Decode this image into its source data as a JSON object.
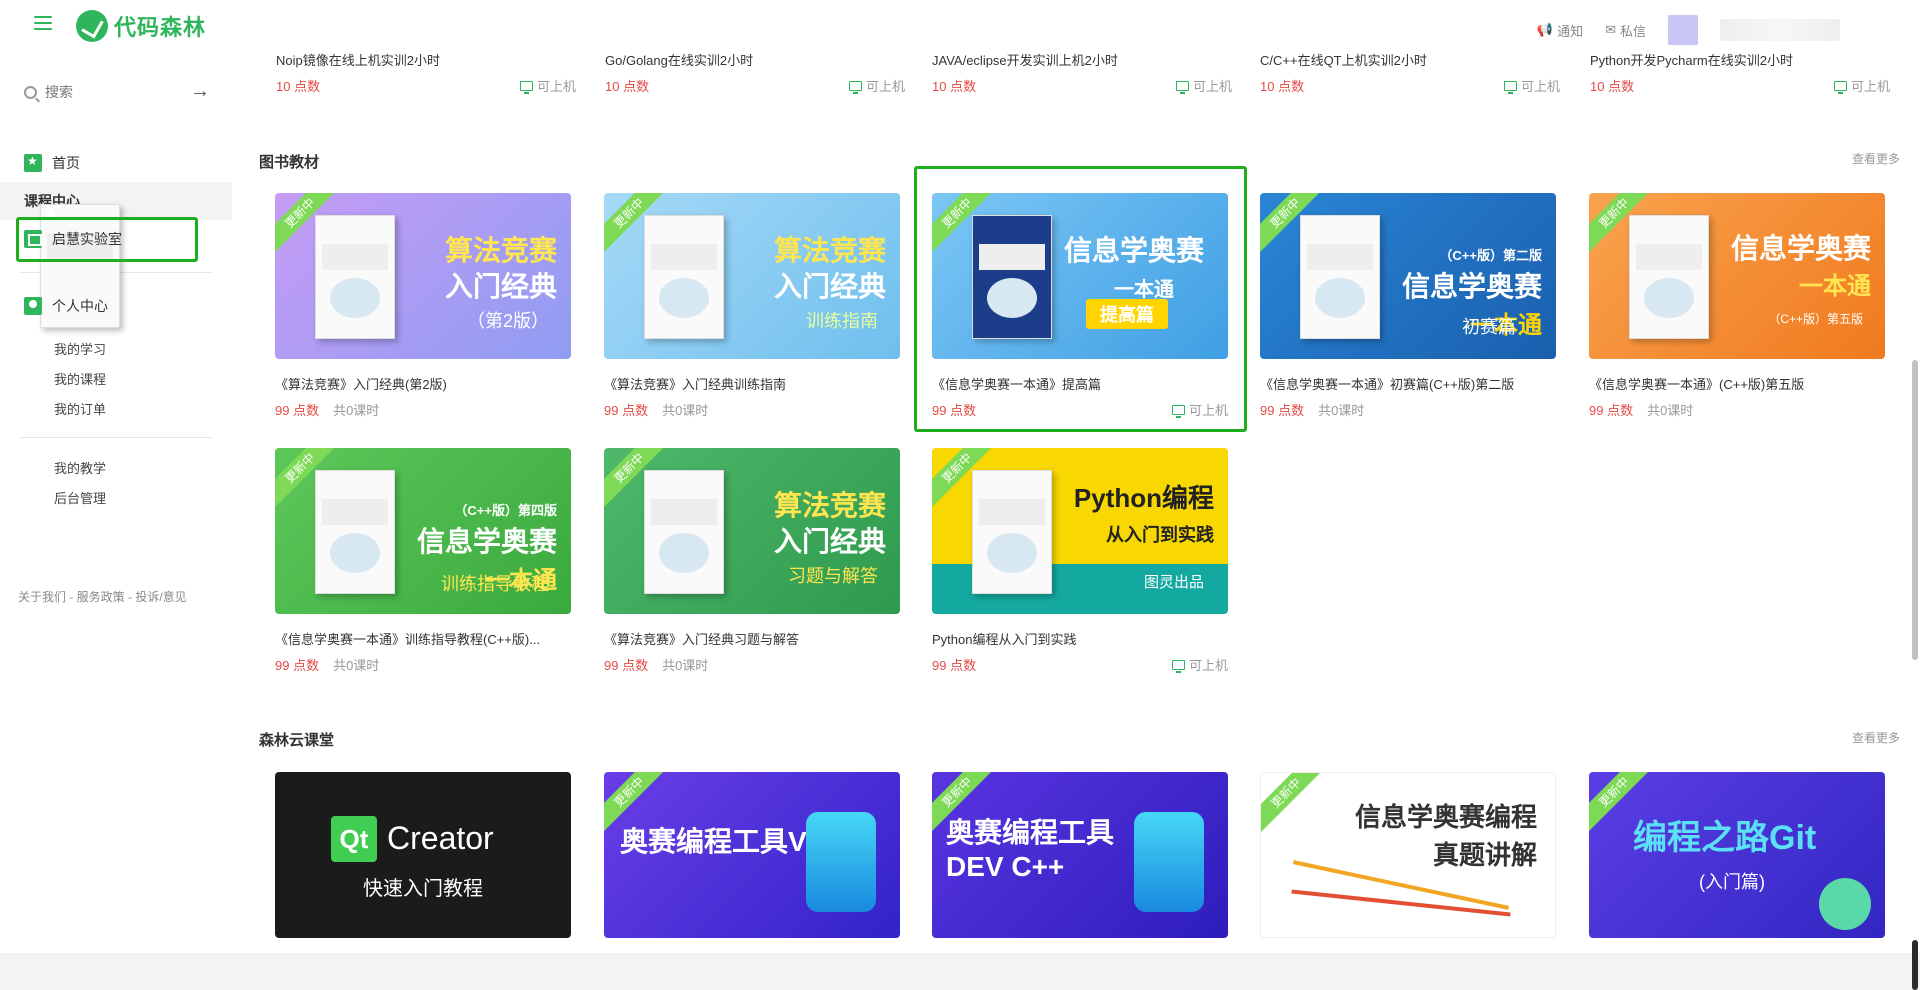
{
  "header": {
    "logo_text": "代码森林",
    "notice": "通知",
    "message": "私信"
  },
  "sidebar": {
    "search_placeholder": "搜索",
    "items": [
      {
        "label": "首页"
      },
      {
        "label": "课程中心"
      },
      {
        "label": "启慧实验室"
      }
    ],
    "personal": "个人中心",
    "sub_items": [
      "我的学习",
      "我的课程",
      "我的订单"
    ],
    "sub_items2": [
      "我的教学",
      "后台管理"
    ],
    "footer": "关于我们 - 服务政策 - 投诉/意见"
  },
  "top_strip": [
    {
      "title": "Noip镜像在线上机实训2小时",
      "price": "10 点数",
      "machine": "可上机"
    },
    {
      "title": "Go/Golang在线实训2小时",
      "price": "10 点数",
      "machine": "可上机"
    },
    {
      "title": "JAVA/eclipse开发实训上机2小时",
      "price": "10 点数",
      "machine": "可上机"
    },
    {
      "title": "C/C++在线QT上机实训2小时",
      "price": "10 点数",
      "machine": "可上机"
    },
    {
      "title": "Python开发Pycharm在线实训2小时",
      "price": "10 点数",
      "machine": "可上机"
    }
  ],
  "books": {
    "title": "图书教材",
    "more": "查看更多",
    "items": [
      {
        "name": "《算法竞赛》入门经典(第2版)",
        "price": "99 点数",
        "lessons": "共0课时",
        "cover_title": "算法竞赛\n入门经典",
        "cover_sub": "（第2版）",
        "ribbon": "更新中",
        "color": "#a89af3"
      },
      {
        "name": "《算法竞赛》入门经典训练指南",
        "price": "99 点数",
        "lessons": "共0课时",
        "cover_title": "算法竞赛\n入门经典",
        "cover_sub": "训练指南",
        "ribbon": "更新中",
        "color": "#7fc8f0"
      },
      {
        "name": "《信息学奥赛一本通》提高篇",
        "price": "99 点数",
        "machine": "可上机",
        "cover_title": "信息学奥赛\n一本通",
        "cover_sub": "提高篇",
        "ribbon": "更新中",
        "color": "#62b4ec"
      },
      {
        "name": "《信息学奥赛一本通》初赛篇(C++版)第二版",
        "price": "99 点数",
        "lessons": "共0课时",
        "cover_title": "信息学奥赛\n一本通",
        "cover_sub": "初赛篇",
        "ribbon": "更新中",
        "color": "#1f72c4"
      },
      {
        "name": "《信息学奥赛一本通》(C++版)第五版",
        "price": "99 点数",
        "lessons": "共0课时",
        "cover_title": "信息学奥赛\n一本通",
        "cover_sub": "（C++版）第五版",
        "ribbon": "更新中",
        "color": "#f58a33"
      },
      {
        "name": "《信息学奥赛一本通》训练指导教程(C++版)...",
        "price": "99 点数",
        "lessons": "共0课时",
        "cover_title": "信息学奥赛\n一本通",
        "cover_sub": "训练指导教程",
        "ribbon": "更新中",
        "color": "#47b94a"
      },
      {
        "name": "《算法竞赛》入门经典习题与解答",
        "price": "99 点数",
        "lessons": "共0课时",
        "cover_title": "算法竞赛\n入门经典",
        "cover_sub": "习题与解答",
        "ribbon": "更新中",
        "color": "#3aa559"
      },
      {
        "name": "Python编程从入门到实践",
        "price": "99 点数",
        "machine": "可上机",
        "cover_title": "Python编程\n从入门到实践",
        "cover_sub": "图灵出品",
        "ribbon": "更新中",
        "color": "#f5d000"
      }
    ]
  },
  "cloud": {
    "title": "森林云课堂",
    "more": "查看更多",
    "items": [
      {
        "cover_title": "Qt Creator\n快速入门教程",
        "color": "#1e1e1e",
        "ribbon": ""
      },
      {
        "cover_title": "奥赛编程工具VS",
        "color": "#4c2fd6",
        "ribbon": "更新中"
      },
      {
        "cover_title": "奥赛编程工具\nDEV C++",
        "color": "#3d22c8",
        "ribbon": "更新中"
      },
      {
        "cover_title": "信息学奥赛编程\n真题讲解",
        "color": "#ffffff",
        "ribbon": "更新中"
      },
      {
        "cover_title": "编程之路Git\n(入门篇)",
        "color": "#3a28c8",
        "ribbon": "更新中"
      }
    ]
  }
}
